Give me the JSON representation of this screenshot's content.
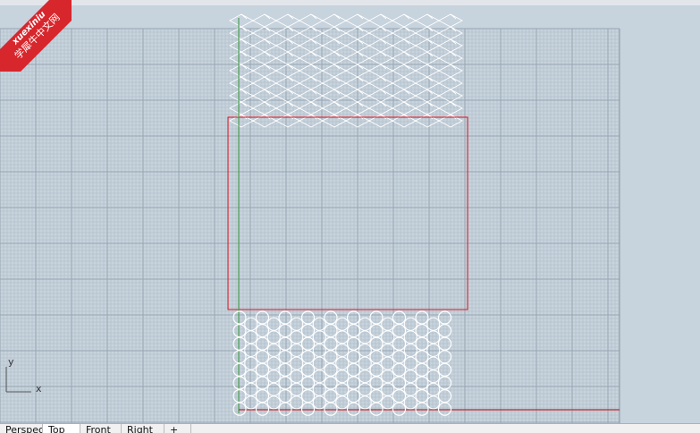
{
  "watermark": {
    "brand_latin": "xuexiniu",
    "brand_cn": "学犀牛中文网"
  },
  "viewport": {
    "axis_y_label": "y",
    "axis_x_label": "x",
    "colors": {
      "background": "#c7d3dd",
      "grid_minor": "#aebbc6",
      "grid_major": "#97a6b2",
      "selection_rect": "#e0141e",
      "green_axis": "#4e9e55",
      "red_axis": "#c0272d",
      "wireframe": "#ffffff"
    }
  },
  "tabs": [
    {
      "label": "Perspective"
    },
    {
      "label": "Top",
      "active": true
    },
    {
      "label": "Front"
    },
    {
      "label": "Right"
    },
    {
      "label": "+"
    }
  ]
}
